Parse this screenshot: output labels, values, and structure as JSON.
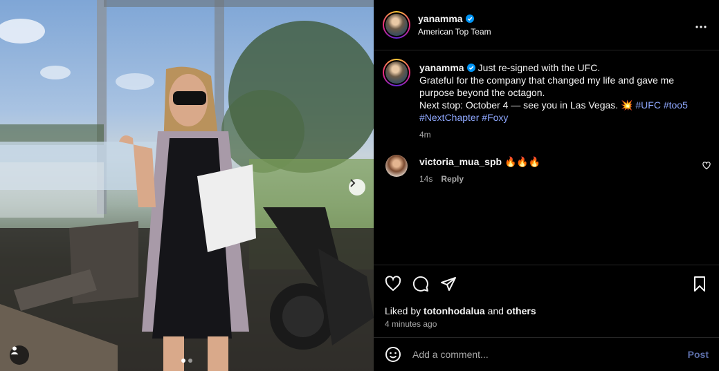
{
  "post": {
    "author": "yanamma",
    "location": "American Top Team",
    "caption_text": "Just re-signed with the UFC.",
    "caption_line2": "Grateful for the company that changed my life and gave me purpose beyond the octagon.",
    "caption_line3": "Next stop: October 4 — see you in Las Vegas. 💥",
    "hashtags": [
      "#UFC",
      "#too5",
      "#NextChapter",
      "#Foxy"
    ],
    "time": "4m"
  },
  "comment": {
    "username": "victoria_mua_spb",
    "text": "🔥🔥🔥",
    "time": "14s",
    "reply_label": "Reply"
  },
  "likes": {
    "prefix": "Liked by",
    "user": "totonhodalua",
    "conj": "and",
    "others": "others",
    "ago": "4 minutes ago"
  },
  "composer": {
    "placeholder": "Add a comment...",
    "post_label": "Post"
  },
  "carousel": {
    "current": 1,
    "total": 2
  },
  "colors": {
    "verified": "#0095f6",
    "hashtag": "#8fa8ff",
    "post_button": "#5c6ea8"
  }
}
